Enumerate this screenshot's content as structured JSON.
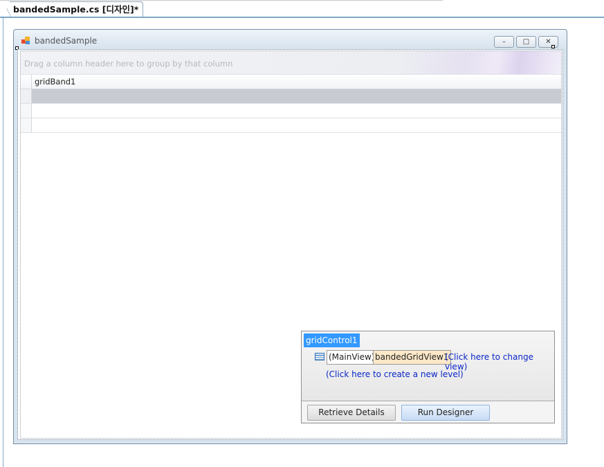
{
  "document_tab": {
    "title": "bandedSample.cs [디자인]*"
  },
  "form": {
    "title": "bandedSample",
    "buttons": {
      "minimize": "–",
      "maximize": "□",
      "close": "✕"
    }
  },
  "grid": {
    "group_panel_hint": "Drag a column header here to group by that column",
    "band_header": "gridBand1",
    "rows": [
      "",
      "",
      ""
    ]
  },
  "smart_tag": {
    "level_title": "gridControl1",
    "main_view": "(MainView)",
    "view_name": "bandedGridView1",
    "change_view_link": "(Click here to change view)",
    "create_level_link": "(Click here to create a new level)",
    "retrieve_button": "Retrieve Details",
    "designer_button": "Run Designer"
  }
}
